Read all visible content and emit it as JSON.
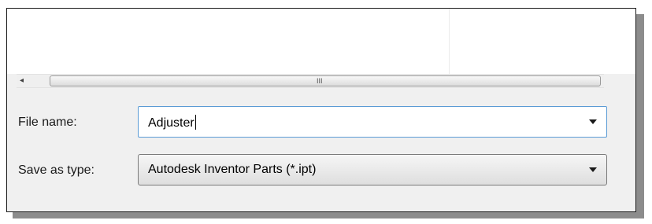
{
  "scrollbar": {
    "left_arrow": "◂",
    "grip": "III"
  },
  "form": {
    "file_name_label": "File name:",
    "file_name_value": "Adjuster",
    "save_as_type_label": "Save as type:",
    "save_as_type_value": "Autodesk Inventor Parts (*.ipt)"
  },
  "icons": {
    "dropdown": "chevron-down-icon",
    "scroll_left": "scroll-left-arrow-icon"
  },
  "colors": {
    "focus_border": "#5b9bd5",
    "dialog_background": "#f0f0f0",
    "shadow": "#8c8c8c"
  }
}
